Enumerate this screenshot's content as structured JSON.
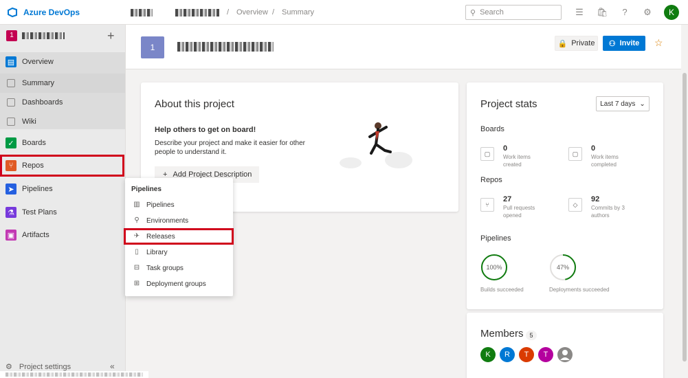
{
  "app": {
    "brand": "Azure DevOps",
    "breadcrumbs": [
      "Overview",
      "Summary"
    ],
    "search_placeholder": "Search",
    "user_initial": "K"
  },
  "sidebar": {
    "project_badge": "1",
    "items": [
      {
        "label": "Overview"
      },
      {
        "label": "Summary"
      },
      {
        "label": "Dashboards"
      },
      {
        "label": "Wiki"
      },
      {
        "label": "Boards"
      },
      {
        "label": "Repos"
      },
      {
        "label": "Pipelines"
      },
      {
        "label": "Test Plans"
      },
      {
        "label": "Artifacts"
      }
    ],
    "settings_label": "Project settings"
  },
  "header": {
    "badge": "1",
    "private_label": "Private",
    "invite_label": "Invite"
  },
  "about": {
    "title": "About this project",
    "help_title": "Help others to get on board!",
    "description": "Describe your project and make it easier for other people to understand it.",
    "add_button": "Add Project Description"
  },
  "stats": {
    "title": "Project stats",
    "range": "Last 7 days",
    "boards_title": "Boards",
    "repos_title": "Repos",
    "pipelines_title": "Pipelines",
    "work_created_value": "0",
    "work_created_label": "Work items created",
    "work_completed_value": "0",
    "work_completed_label": "Work items completed",
    "prs_value": "27",
    "prs_label": "Pull requests opened",
    "commits_value": "92",
    "commits_label": "Commits by 3 authors",
    "builds_pct": "100%",
    "builds_fraction": 1.0,
    "builds_label": "Builds succeeded",
    "deploys_pct": "47%",
    "deploys_fraction": 0.47,
    "deploys_label": "Deployments succeeded"
  },
  "members": {
    "title": "Members",
    "count": "5",
    "avatars": [
      {
        "initial": "K",
        "color": "#107c10"
      },
      {
        "initial": "R",
        "color": "#0078d4"
      },
      {
        "initial": "T",
        "color": "#da3b01"
      },
      {
        "initial": "T",
        "color": "#b4009e"
      },
      {
        "initial": "",
        "color": "#8a8886"
      }
    ]
  },
  "flyout": {
    "title": "Pipelines",
    "items": [
      {
        "label": "Pipelines"
      },
      {
        "label": "Environments"
      },
      {
        "label": "Releases"
      },
      {
        "label": "Library"
      },
      {
        "label": "Task groups"
      },
      {
        "label": "Deployment groups"
      }
    ]
  },
  "colors": {
    "accent": "#0078d4",
    "highlight": "#d0021b",
    "success": "#107c10"
  }
}
